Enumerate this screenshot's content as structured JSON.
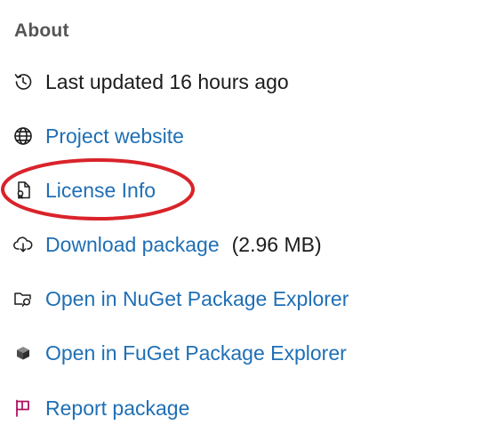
{
  "about": {
    "heading": "About",
    "last_updated": {
      "icon": "history-icon",
      "text": "Last updated 16 hours ago"
    },
    "project_website": {
      "icon": "globe-icon",
      "label": "Project website"
    },
    "license_info": {
      "icon": "license-file-icon",
      "label": "License Info"
    },
    "download_package": {
      "icon": "cloud-download-icon",
      "label": "Download package",
      "size": "(2.96 MB)"
    },
    "nuget_explorer": {
      "icon": "folder-search-icon",
      "label": "Open in NuGet Package Explorer"
    },
    "fuget_explorer": {
      "icon": "package-cube-icon",
      "label": "Open in FuGet Package Explorer"
    },
    "report_package": {
      "icon": "flag-icon",
      "label": "Report package"
    }
  },
  "colors": {
    "link": "#1f6fb5",
    "heading": "#555555",
    "annotation_ellipse": "#d9232a",
    "flag": "#b0125f"
  }
}
